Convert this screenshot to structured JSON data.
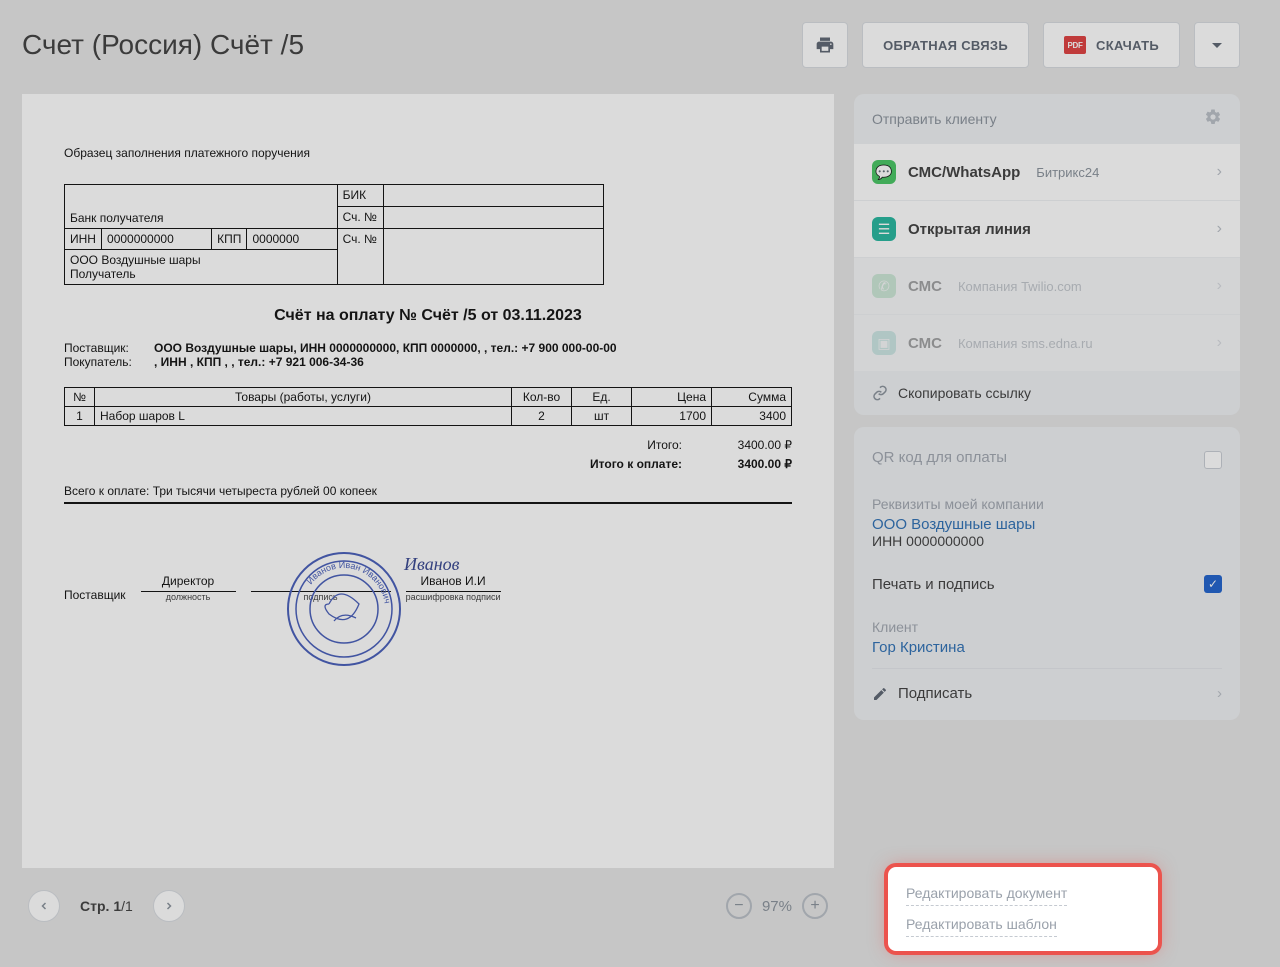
{
  "header": {
    "title": "Счет (Россия) Счёт /5",
    "feedback": "ОБРАТНАЯ СВЯЗЬ",
    "download": "СКАЧАТЬ",
    "pdf_badge": "PDF"
  },
  "document": {
    "sample_label": "Образец заполнения платежного поручения",
    "bank": {
      "bank_recipient_label": "Банк получателя",
      "bik_label": "БИК",
      "sch1_label": "Сч. №",
      "sch2_label": "Сч. №",
      "inn_label": "ИНН",
      "inn_value": "0000000000",
      "kpp_label": "КПП",
      "kpp_value": "0000000",
      "recipient_name": "ООО Воздушные шары",
      "recipient_label": "Получатель"
    },
    "title": "Счёт на оплату № Счёт /5 от 03.11.2023",
    "supplier_label": "Поставщик:",
    "supplier_value": "ООО Воздушные шары, ИНН 0000000000, КПП 0000000, , тел.: +7 900 000-00-00",
    "buyer_label": "Покупатель:",
    "buyer_value": ", ИНН , КПП , , тел.: +7 921 006-34-36",
    "table": {
      "headers": {
        "num": "№",
        "name": "Товары (работы, услуги)",
        "qty": "Кол-во",
        "unit": "Ед.",
        "price": "Цена",
        "sum": "Сумма"
      },
      "rows": [
        {
          "num": "1",
          "name": "Набор шаров L",
          "qty": "2",
          "unit": "шт",
          "price": "1700",
          "sum": "3400"
        }
      ]
    },
    "totals": {
      "itogo_label": "Итого:",
      "itogo_value": "3400.00 ₽",
      "pay_label": "Итого к оплате:",
      "pay_value": "3400.00 ₽"
    },
    "in_words_label": "Всего к оплате:",
    "in_words": "Три тысячи четыреста рублей 00 копеек",
    "sign": {
      "supplier": "Поставщик",
      "position": "Директор",
      "position_cap": "должность",
      "sign_cap": "подпись",
      "name": "Иванов И.И",
      "name_cap": "расшифровка подписи",
      "stamp_text": "Иванов Иван Иванович"
    }
  },
  "pager": {
    "label": "Стр.",
    "current": "1",
    "total": "/1",
    "zoom": "97%"
  },
  "side": {
    "send_title": "Отправить клиенту",
    "items": [
      {
        "icon": "sms",
        "color": "#3bc259",
        "title": "СМС/WhatsApp",
        "sub": "Битрикс24",
        "dim": false
      },
      {
        "icon": "ol",
        "color": "#17b198",
        "title": "Открытая линия",
        "sub": "",
        "dim": false
      },
      {
        "icon": "wa",
        "color": "#9cdcaf",
        "title": "СМС",
        "sub": "Компания Twilio.com",
        "dim": true
      },
      {
        "icon": "sms2",
        "color": "#9cd6cf",
        "title": "СМС",
        "sub": "Компания sms.edna.ru",
        "dim": true
      }
    ],
    "copy_link": "Скопировать ссылку",
    "qr_title": "QR код для оплаты",
    "req_title": "Реквизиты моей компании",
    "company": "ООО Воздушные шары",
    "company_inn": "ИНН 0000000000",
    "stamp_sign": "Печать и подпись",
    "client_title": "Клиент",
    "client_name": "Гор Кристина",
    "sign_action": "Подписать"
  },
  "edit_box": {
    "doc": "Редактировать документ",
    "tpl": "Редактировать шаблон"
  }
}
